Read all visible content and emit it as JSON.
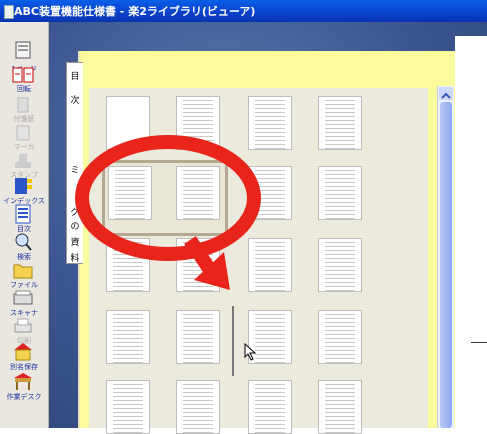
{
  "window": {
    "title": "ABC装置機能仕様書 - 楽2ライブラリ(ビューア)"
  },
  "toolbar": {
    "items": [
      {
        "label": "1ページ",
        "icon": "single-page-icon"
      },
      {
        "label": "回転",
        "icon": "rotate-icon"
      },
      {
        "label": "付箋紙",
        "icon": "sticky-note-icon"
      },
      {
        "label": "マーカ",
        "icon": "marker-icon"
      },
      {
        "label": "スタンプ",
        "icon": "stamp-icon"
      },
      {
        "label": "インデックス",
        "icon": "index-icon"
      },
      {
        "label": "目次",
        "icon": "toc-icon"
      },
      {
        "label": "検索",
        "icon": "search-icon"
      },
      {
        "label": "ファイル",
        "icon": "folder-icon"
      },
      {
        "label": "スキャナ",
        "icon": "scanner-icon"
      },
      {
        "label": "印刷",
        "icon": "printer-icon"
      },
      {
        "label": "別名保存",
        "icon": "save-as-icon"
      },
      {
        "label": "作業デスク",
        "icon": "desk-icon"
      }
    ]
  },
  "tabs": [
    {
      "label": "目"
    },
    {
      "label": "次"
    },
    {
      "label": "ミ"
    },
    {
      "label": "グ"
    },
    {
      "label": "の"
    },
    {
      "label": "資"
    },
    {
      "label": "料"
    }
  ],
  "colors": {
    "annotation": "#e8241b",
    "page_bg": "#fbfa9c",
    "frame": "#3c5590"
  }
}
